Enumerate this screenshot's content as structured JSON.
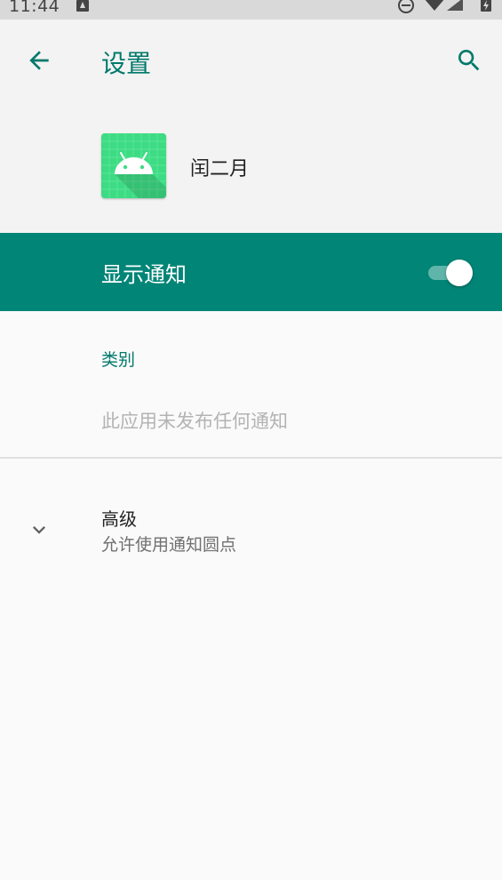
{
  "status_bar": {
    "time": "11:44"
  },
  "toolbar": {
    "title": "设置",
    "back_icon": "arrow-back-icon",
    "search_icon": "search-icon"
  },
  "app": {
    "name": "闰二月",
    "icon": "android-app-icon"
  },
  "notifications_toggle": {
    "label": "显示通知",
    "state": "on"
  },
  "category": {
    "header": "类别",
    "empty_message": "此应用未发布任何通知"
  },
  "advanced": {
    "title": "高级",
    "summary": "允许使用通知圆点",
    "icon": "chevron-down-icon"
  },
  "colors": {
    "accent": "#008577",
    "title_teal": "#00796b",
    "app_icon_green": "#3ddc84"
  }
}
